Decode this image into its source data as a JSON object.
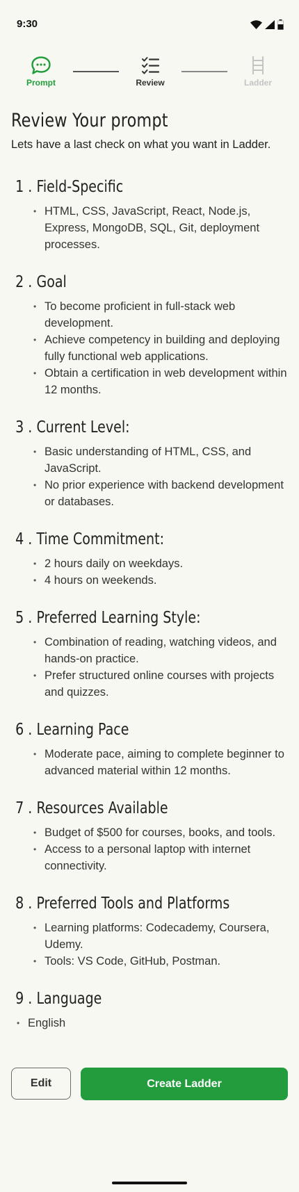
{
  "status_bar": {
    "time": "9:30"
  },
  "stepper": {
    "steps": [
      {
        "label": "Prompt",
        "icon": "chat-bubble-icon",
        "state": "active",
        "color": "#239c3e"
      },
      {
        "label": "Review",
        "icon": "checklist-icon",
        "state": "current",
        "color": "#333333"
      },
      {
        "label": "Ladder",
        "icon": "ladder-icon",
        "state": "disabled",
        "color": "#c4c4c4"
      }
    ]
  },
  "page": {
    "title": "Review Your prompt",
    "subtitle": "Lets have a last check on what you want in Ladder."
  },
  "sections": [
    {
      "num": "1 .",
      "title": "Field-Specific",
      "items": [
        "HTML, CSS, JavaScript, React, Node.js, Express, MongoDB, SQL, Git, deployment processes."
      ]
    },
    {
      "num": "2 .",
      "title": "Goal",
      "items": [
        "To become proficient in full-stack web development.",
        "Achieve competency in building and deploying fully functional web applications.",
        "Obtain a certification in web development within 12 months."
      ]
    },
    {
      "num": "3 .",
      "title": "Current Level:",
      "items": [
        "Basic understanding of HTML, CSS, and JavaScript.",
        "No prior experience with backend development or databases."
      ]
    },
    {
      "num": "4 .",
      "title": "Time Commitment:",
      "items": [
        "2 hours daily on weekdays.",
        "4 hours on weekends."
      ]
    },
    {
      "num": "5 .",
      "title": "Preferred Learning Style:",
      "items": [
        "Combination of reading, watching videos, and hands-on practice.",
        "Prefer structured online courses with projects and quizzes."
      ]
    },
    {
      "num": "6 .",
      "title": "Learning Pace",
      "items": [
        "Moderate pace, aiming to complete beginner to advanced material within 12 months."
      ]
    },
    {
      "num": "7 .",
      "title": "Resources Available",
      "items": [
        "Budget of $500 for courses, books, and tools.",
        "Access to a personal laptop with internet connectivity."
      ]
    },
    {
      "num": "8 .",
      "title": "Preferred Tools and Platforms",
      "items": [
        "Learning platforms: Codecademy, Coursera, Udemy.",
        "Tools: VS Code, GitHub, Postman."
      ]
    },
    {
      "num": "9 .",
      "title": "Language",
      "items": [
        "English"
      ]
    }
  ],
  "actions": {
    "edit_label": "Edit",
    "create_label": "Create Ladder",
    "primary_color": "#239c3e"
  }
}
